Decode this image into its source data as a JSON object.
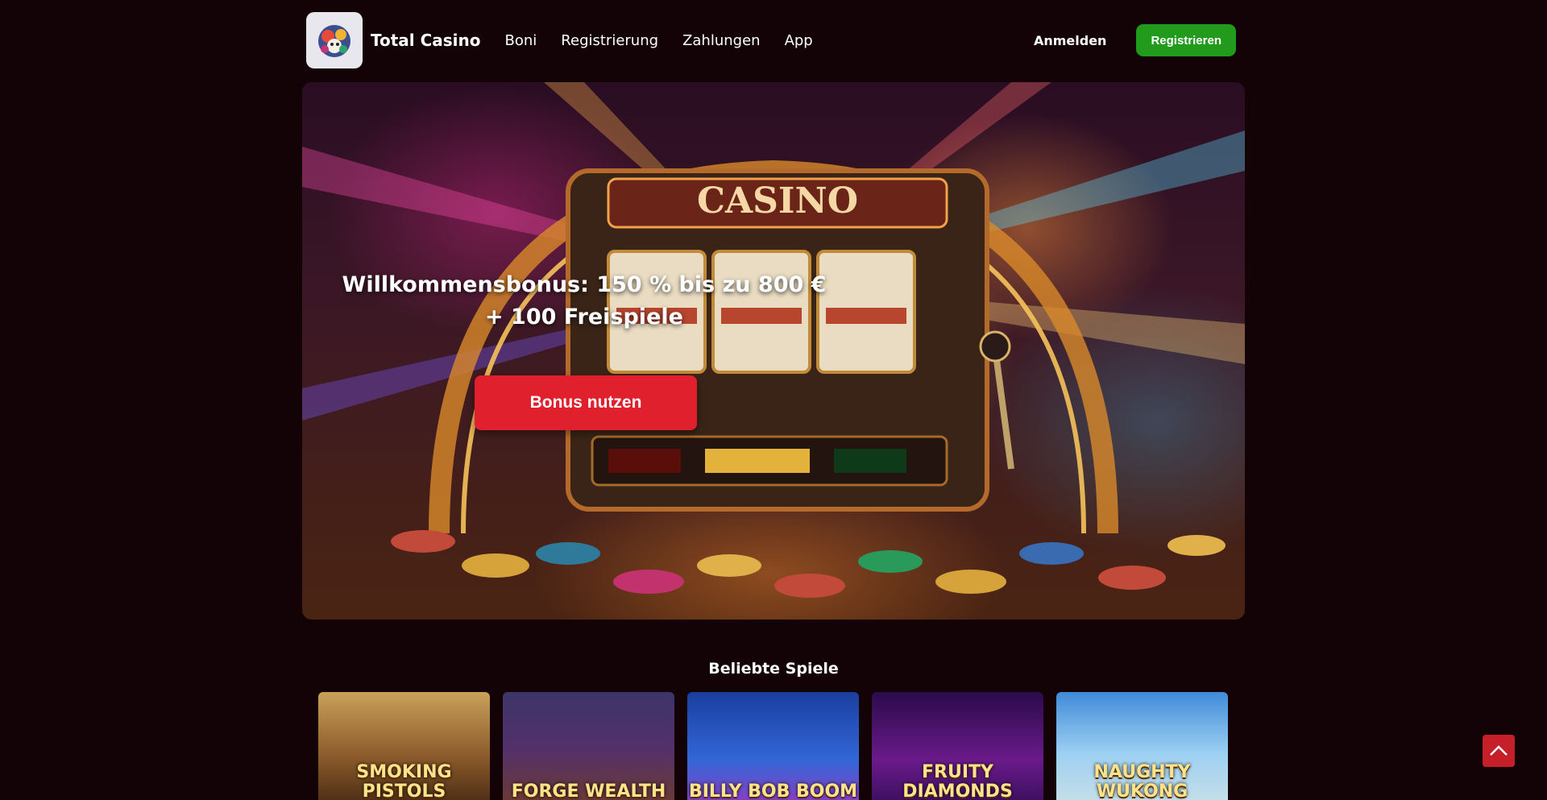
{
  "header": {
    "brand": "Total Casino",
    "nav": [
      "Boni",
      "Registrierung",
      "Zahlungen",
      "App"
    ],
    "login_label": "Anmelden",
    "register_label": "Registrieren"
  },
  "hero": {
    "title": "Willkommensbonus: 150 % bis zu 800 € + 100 Freispiele",
    "button_label": "Bonus nutzen"
  },
  "games": {
    "title": "Beliebte Spiele",
    "items": [
      {
        "name": "SMOKING PISTOLS"
      },
      {
        "name": "FORGE WEALTH"
      },
      {
        "name": "BILLY BOB BOOM"
      },
      {
        "name": "FRUITY DIAMONDS"
      },
      {
        "name": "NAUGHTY WUKONG"
      }
    ]
  },
  "colors": {
    "background": "#140306",
    "register_button": "#229a1c",
    "bonus_button": "#e0202c",
    "scroll_top": "#c5202a"
  },
  "icons": [
    "logo-icon",
    "chevron-up-icon"
  ]
}
